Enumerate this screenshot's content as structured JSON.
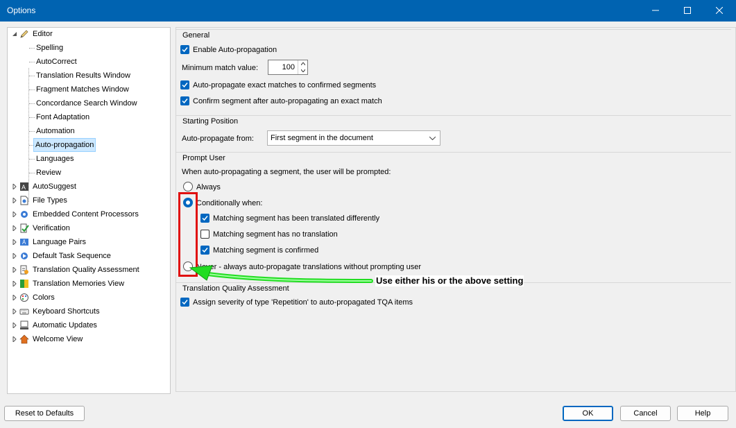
{
  "window": {
    "title": "Options",
    "controls": [
      "minimize-icon",
      "maximize-icon",
      "close-icon"
    ]
  },
  "tree": {
    "editor": "Editor",
    "editor_children": [
      "Spelling",
      "AutoCorrect",
      "Translation Results Window",
      "Fragment Matches Window",
      "Concordance Search Window",
      "Font Adaptation",
      "Automation",
      "Auto-propagation",
      "Languages",
      "Review"
    ],
    "selected": "Auto-propagation",
    "others": [
      "AutoSuggest",
      "File Types",
      "Embedded Content Processors",
      "Verification",
      "Language Pairs",
      "Default Task Sequence",
      "Translation Quality Assessment",
      "Translation Memories View",
      "Colors",
      "Keyboard Shortcuts",
      "Automatic Updates",
      "Welcome View"
    ]
  },
  "general": {
    "title": "General",
    "enable_label": "Enable Auto-propagation",
    "enable_checked": true,
    "min_match_label": "Minimum match value:",
    "min_match_value": "100",
    "exact_label": "Auto-propagate exact matches to confirmed segments",
    "exact_checked": true,
    "confirm_label": "Confirm segment after auto-propagating an exact match",
    "confirm_checked": true
  },
  "starting": {
    "title": "Starting Position",
    "from_label": "Auto-propagate from:",
    "from_value": "First segment in the document"
  },
  "prompt": {
    "title": "Prompt User",
    "intro": "When auto-propagating a segment, the user will be prompted:",
    "always": "Always",
    "conditionally": "Conditionally when:",
    "selected": "Conditionally when:",
    "cond_translated_diff": "Matching segment has been translated differently",
    "cond_translated_diff_checked": true,
    "cond_no_translation": "Matching segment has no translation",
    "cond_no_translation_checked": false,
    "cond_confirmed": "Matching segment is confirmed",
    "cond_confirmed_checked": true,
    "never": "Never - always auto-propagate translations without prompting user"
  },
  "tqa": {
    "title": "Translation Quality Assessment",
    "assign_label": "Assign severity of type 'Repetition' to auto-propagated TQA items",
    "assign_checked": true
  },
  "annotation": {
    "text": "Use either his or the above setting",
    "box_color": "#e01010",
    "arrow_color": "#22dd22"
  },
  "buttons": {
    "reset": "Reset to Defaults",
    "ok": "OK",
    "cancel": "Cancel",
    "help": "Help"
  },
  "colors": {
    "titlebar": "#0063b1",
    "accent": "#0067c0",
    "selection": "#cce8ff"
  }
}
